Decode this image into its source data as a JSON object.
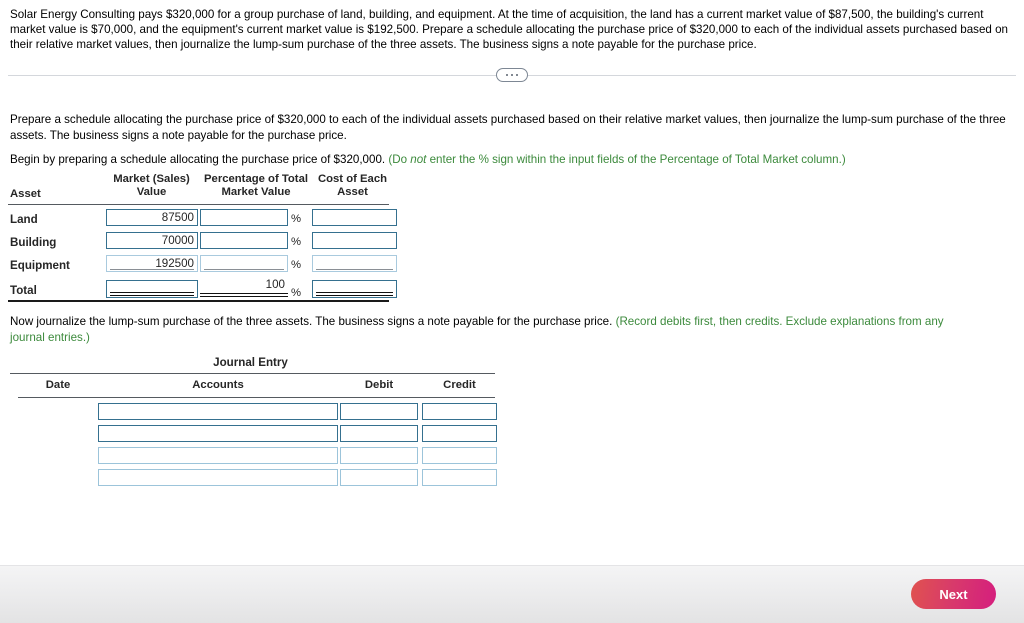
{
  "problem": {
    "text": "Solar Energy Consulting pays $320,000 for a group purchase of land, building, and equipment. At the time of acquisition, the land has a current market value of $87,500, the building's current market value is $70,000, and the equipment's current market value is $192,500. Prepare a schedule allocating the purchase price of $320,000 to each of the individual assets purchased based on their relative market values, then journalize the lump-sum purchase of the three assets. The business signs a note payable for the purchase price."
  },
  "divider": {
    "dots": "..."
  },
  "instructions": {
    "requirement": "Prepare a schedule allocating the purchase price of $320,000 to each of the individual assets purchased based on their relative market values, then journalize the lump-sum purchase of the three assets. The business signs a note payable for the purchase price.",
    "schedule_prompt": "Begin by preparing a schedule allocating the purchase price of $320,000. ",
    "schedule_hint_pre": "(Do ",
    "schedule_hint_italic": "not",
    "schedule_hint_post": " enter the % sign within the input fields of the Percentage of Total Market column.)",
    "journal_prompt": "Now journalize the lump-sum purchase of the three assets. The business signs a note payable for the purchase price. ",
    "journal_hint": "(Record debits first, then credits. Exclude explanations from any journal entries.)"
  },
  "allocation_table": {
    "headers": {
      "asset": "Asset",
      "market_value_line1": "Market (Sales)",
      "market_value_line2": "Value",
      "percentage_line1": "Percentage of Total",
      "percentage_line2": "Market Value",
      "cost_line1": "Cost of Each",
      "cost_line2": "Asset"
    },
    "percent_symbol": "%",
    "rows": [
      {
        "label": "Land",
        "market_value": "87500",
        "percentage": "",
        "cost": ""
      },
      {
        "label": "Building",
        "market_value": "70000",
        "percentage": "",
        "cost": ""
      },
      {
        "label": "Equipment",
        "market_value": "192500",
        "percentage": "",
        "cost": ""
      },
      {
        "label": "Total",
        "market_value": "",
        "percentage": "100",
        "cost": ""
      }
    ]
  },
  "journal_table": {
    "title": "Journal Entry",
    "headers": {
      "date": "Date",
      "accounts": "Accounts",
      "debit": "Debit",
      "credit": "Credit"
    },
    "rows": [
      {
        "date": "",
        "accounts": "",
        "debit": "",
        "credit": ""
      },
      {
        "date": "",
        "accounts": "",
        "debit": "",
        "credit": ""
      },
      {
        "date": "",
        "accounts": "",
        "debit": "",
        "credit": ""
      },
      {
        "date": "",
        "accounts": "",
        "debit": "",
        "credit": ""
      }
    ]
  },
  "footer": {
    "next_label": "Next"
  },
  "colors": {
    "input_border": "#35708f",
    "hint_green": "#3c8a3c",
    "next_gradient_start": "#e0524f",
    "next_gradient_end": "#d51e7e",
    "rule_dark": "#1a1a1a"
  }
}
